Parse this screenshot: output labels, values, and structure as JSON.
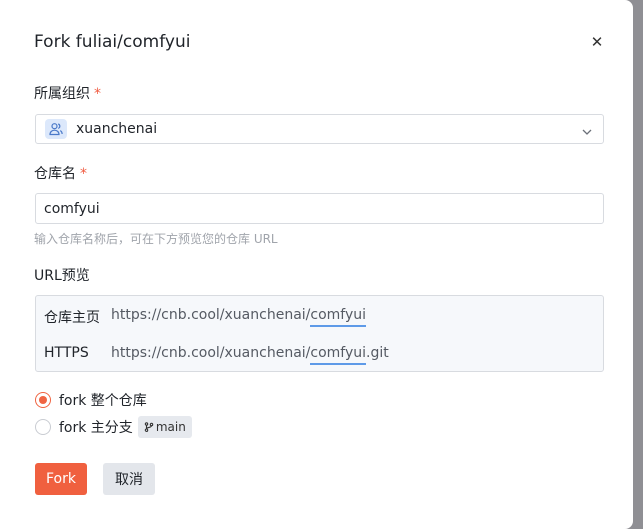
{
  "dialog": {
    "title": "Fork fuliai/comfyui",
    "close_glyph": "✕"
  },
  "org": {
    "label": "所属组织",
    "required_mark": "*",
    "value": "xuanchenai",
    "icon": "users-icon"
  },
  "repo_name": {
    "label": "仓库名",
    "required_mark": "*",
    "value": "comfyui",
    "hint": "输入仓库名称后，可在下方预览您的仓库 URL"
  },
  "url_preview": {
    "label": "URL预览",
    "home_key": "仓库主页",
    "home_prefix": "https://cnb.cool/xuanchenai/",
    "home_repo": "comfyui",
    "https_key": "HTTPS",
    "https_prefix": "https://cnb.cool/xuanchenai/",
    "https_repo": "comfyui",
    "https_suffix": ".git"
  },
  "options": {
    "whole": "fork 整个仓库",
    "main_branch": "fork 主分支",
    "branch_tag": "main",
    "selected": "whole"
  },
  "buttons": {
    "fork": "Fork",
    "cancel": "取消"
  },
  "colors": {
    "accent": "#f0603f",
    "required": "#f05b41",
    "link_underline": "#5e9ae8"
  }
}
